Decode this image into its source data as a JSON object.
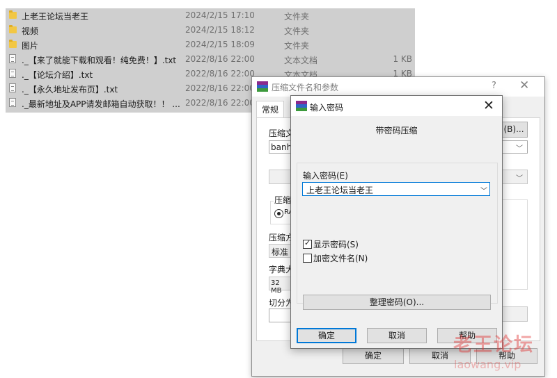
{
  "explorer": {
    "files": [
      {
        "kind": "folder",
        "name": "上老王论坛当老王",
        "date": "2024/2/15 17:10",
        "type": "文件夹",
        "size": ""
      },
      {
        "kind": "folder",
        "name": "视频",
        "date": "2024/2/15 18:12",
        "type": "文件夹",
        "size": ""
      },
      {
        "kind": "folder",
        "name": "图片",
        "date": "2024/2/15 18:09",
        "type": "文件夹",
        "size": ""
      },
      {
        "kind": "text",
        "name": "._【来了就能下载和观看！纯免费！】.txt",
        "date": "2022/8/16 22:00",
        "type": "文本文档",
        "size": "1 KB"
      },
      {
        "kind": "text",
        "name": "._【论坛介绍】.txt",
        "date": "2022/8/16 22:00",
        "type": "文本文档",
        "size": "1 KB"
      },
      {
        "kind": "text",
        "name": "._【永久地址发布页】.txt",
        "date": "2022/8/16 22:00",
        "type": "",
        "size": ""
      },
      {
        "kind": "text",
        "name": "._最新地址及APP请发邮箱自动获取！！ ...",
        "date": "2022/8/16 22:00",
        "type": "",
        "size": ""
      }
    ]
  },
  "archive_dialog": {
    "title": "压缩文件名和参数",
    "help": "?",
    "close": "✕",
    "tab_general": "常规",
    "archive_label": "压缩文",
    "archive_value": "banhe",
    "browse_suffix": "(B)...",
    "format_label": "压缩",
    "format_radio": "RA",
    "method_label": "压缩方",
    "method_value": "标准",
    "dict_label": "字典大",
    "dict_value": "32 MB",
    "split_label": "切分为",
    "ok": "确定",
    "cancel": "取消",
    "help_btn": "帮助"
  },
  "password_dialog": {
    "title": "输入密码",
    "close": "✕",
    "subtitle": "带密码压缩",
    "password_label": "输入密码(E)",
    "password_value": "上老王论坛当老王",
    "show_password_label": "显示密码(S)",
    "show_password_checked": true,
    "encrypt_names_label": "加密文件名(N)",
    "encrypt_names_checked": false,
    "check_mark": "✓",
    "organize_label": "整理密码(O)...",
    "ok": "确定",
    "cancel": "取消",
    "help": "帮助"
  },
  "watermark": {
    "main": "老王论坛",
    "sub": "laowang.vip"
  },
  "icons": {
    "folder": "folder-icon",
    "text_file": "text-file-icon",
    "winrar": "winrar-icon",
    "dropdown": "chevron-down-icon",
    "chevron_char": "﹀"
  },
  "colors": {
    "selection_bg": "#cfcfcf",
    "focus_border": "#0078d7",
    "watermark": "#e03838",
    "folder": "#f2c744"
  }
}
